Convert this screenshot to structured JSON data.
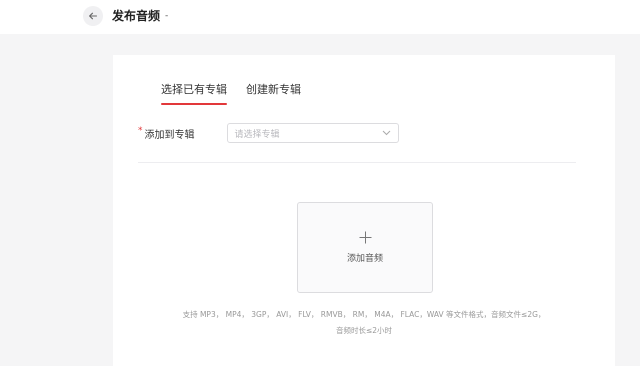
{
  "header": {
    "title": "发布音频",
    "back_icon": "arrow-left-icon",
    "caret": "-"
  },
  "tabs": [
    {
      "label": "选择已有专辑",
      "active": true
    },
    {
      "label": "创建新专辑",
      "active": false
    }
  ],
  "form": {
    "required_mark": "*",
    "album_label": "添加到专辑",
    "album_placeholder": "请选择专辑",
    "dropdown_icon": "chevron-down-icon"
  },
  "upload": {
    "icon": "plus-icon",
    "label": "添加音频",
    "hint_line1": "支持 MP3， MP4， 3GP， AVI， FLV， RMVB， RM， M4A， FLAC，WAV 等文件格式，音频文件≤2G，",
    "hint_line2": "音频时长≤2小时"
  },
  "colors": {
    "accent": "#e2383a",
    "page_bg": "#f5f5f6",
    "card_bg": "#ffffff"
  }
}
